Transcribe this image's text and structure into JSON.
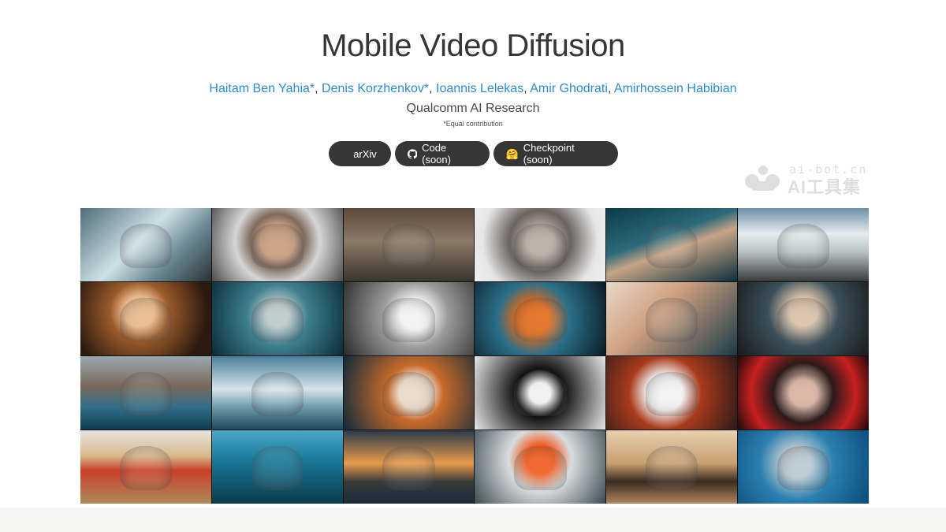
{
  "title": "Mobile Video Diffusion",
  "authors": [
    {
      "name": "Haitam Ben Yahia*"
    },
    {
      "name": "Denis Korzhenkov*"
    },
    {
      "name": "Ioannis Lelekas"
    },
    {
      "name": "Amir Ghodrati"
    },
    {
      "name": "Amirhossein Habibian"
    }
  ],
  "separator": ", ",
  "affiliation": "Qualcomm AI Research",
  "equal_note": "*Equal contribution",
  "buttons": {
    "arxiv": {
      "label": "arXiv",
      "icon": "arxiv-icon"
    },
    "code": {
      "label": "Code (soon)",
      "icon": "github-icon"
    },
    "checkpoint": {
      "label": "Checkpoint (soon)",
      "icon": "hugging-face-icon"
    }
  },
  "watermark": {
    "top": "ai-bot.cn",
    "bottom": "AI工具集"
  },
  "colors": {
    "text": "#363636",
    "link": "#2a8bd0",
    "button_bg": "#363636",
    "footer_bg": "#f5f5f3"
  },
  "gallery": [
    {
      "name": "tile-waterfall",
      "icon": "waterfall-image",
      "bg": "linear-gradient(135deg,#4f6e78 0%,#cfe0e6 45%,#6a8892 70%,#2b3236 100%)"
    },
    {
      "name": "tile-woman-veil",
      "icon": "portrait-image",
      "bg": "radial-gradient(circle at 50% 45%,#c79a7a 0 22%,#7e6a5e 35%,#d6d6d6 55%,#4b4b4b 100%)"
    },
    {
      "name": "tile-pandas",
      "icon": "panda-image",
      "bg": "linear-gradient(180deg,#5a4a3c 0%,#8b7a66 45%,#3a3530 100%)"
    },
    {
      "name": "tile-spider",
      "icon": "spider-image",
      "bg": "radial-gradient(circle at 50% 45%,#b7aaa0 0 18%,#6a6360 40%,#e6e6e6 75%,#f0f0f0 100%)"
    },
    {
      "name": "tile-fish",
      "icon": "fish-image",
      "bg": "linear-gradient(160deg,#0c3a4a 0%,#2c6a7a 40%,#c6a486 55%,#0e2f3c 100%)"
    },
    {
      "name": "tile-train",
      "icon": "train-image",
      "bg": "linear-gradient(180deg,#6d8fa8 0%,#e6ecef 35%,#b8c2c6 60%,#3a3a3a 100%)"
    },
    {
      "name": "tile-curly-woman",
      "icon": "portrait-image",
      "bg": "radial-gradient(circle at 45% 40%,#e8b88a 0 18%,#9a5a2a 35%,#2b1a10 80%)"
    },
    {
      "name": "tile-chair",
      "icon": "chair-image",
      "bg": "radial-gradient(circle at 50% 45%,#bdc8c8 0 15%,#3d7f8f 40%,#0a2a36 100%)"
    },
    {
      "name": "tile-explosion",
      "icon": "explosion-image",
      "bg": "radial-gradient(circle at 55% 45%,#f2f2f2 0 18%,#9a9a9a 40%,#2a2a2a 100%)"
    },
    {
      "name": "tile-dragon",
      "icon": "dragon-image",
      "bg": "radial-gradient(circle at 45% 50%,#e06a1a 0 20%,#2a6f8a 45%,#0b1a22 100%)"
    },
    {
      "name": "tile-cyborg-woman",
      "icon": "portrait-image",
      "bg": "linear-gradient(135deg,#e8d8c8 0%,#cfa080 40%,#1a3a48 100%)"
    },
    {
      "name": "tile-hooded-woman",
      "icon": "portrait-image",
      "bg": "radial-gradient(circle at 50% 40%,#d8c0a8 0 18%,#3a4f5a 45%,#1a1a1a 100%)"
    },
    {
      "name": "tile-coast",
      "icon": "coast-image",
      "bg": "linear-gradient(180deg,#9aa8b0 0%,#7a6a5a 40%,#2f6f8a 70%,#0e3a4a 100%)"
    },
    {
      "name": "tile-waves",
      "icon": "waves-image",
      "bg": "linear-gradient(180deg,#4a7f9a 0%,#d8e4ea 45%,#6a9aaa 70%,#1a4a5a 100%)"
    },
    {
      "name": "tile-candle-woman",
      "icon": "portrait-image",
      "bg": "radial-gradient(circle at 55% 50%,#e8d8c8 0 20%,#c86a2a 35%,#0e2a3a 100%)"
    },
    {
      "name": "tile-astronaut",
      "icon": "astronaut-image",
      "bg": "radial-gradient(circle at 50% 50%,#f0f0f0 0 14%,#101010 32%,#5a5a5a 55%,#e8e8e8 100%)"
    },
    {
      "name": "tile-horse",
      "icon": "horse-image",
      "bg": "radial-gradient(circle at 45% 50%,#f2f2f2 0 22%,#a83a1a 45%,#2a1a1a 100%)"
    },
    {
      "name": "tile-red-woman",
      "icon": "portrait-image",
      "bg": "radial-gradient(circle at 50% 50%,#d8b0a0 0 18%,#2a1a1a 40%,#c82020 70%,#1a0a0a 100%)"
    },
    {
      "name": "tile-red-car",
      "icon": "car-image",
      "bg": "linear-gradient(180deg,#e8e4e0 0%,#d8b88a 35%,#c8402a 55%,#b08a5a 100%)"
    },
    {
      "name": "tile-underwater",
      "icon": "underwater-image",
      "bg": "linear-gradient(180deg,#4aa8c8 0%,#1a7a9a 40%,#0a3a4a 100%)"
    },
    {
      "name": "tile-ship",
      "icon": "ship-image",
      "bg": "linear-gradient(180deg,#2a3a4a 0%,#e89a4a 45%,#3a3a3a 70%,#1a2a3a 100%)"
    },
    {
      "name": "tile-burning-ruins",
      "icon": "fire-image",
      "bg": "radial-gradient(circle at 50% 40%,#f05a1a 0 18%,#d8dcdf 40%,#3a4a52 100%)"
    },
    {
      "name": "tile-cowboy",
      "icon": "cowboy-image",
      "bg": "linear-gradient(180deg,#e8d0b0 0%,#c8a070 45%,#3a2a20 70%,#b08860 100%)"
    },
    {
      "name": "tile-dolphin",
      "icon": "dolphin-image",
      "bg": "radial-gradient(circle at 45% 45%,#b8c8d0 0 18%,#2a7fb0 45%,#0a4a7a 100%)"
    }
  ]
}
